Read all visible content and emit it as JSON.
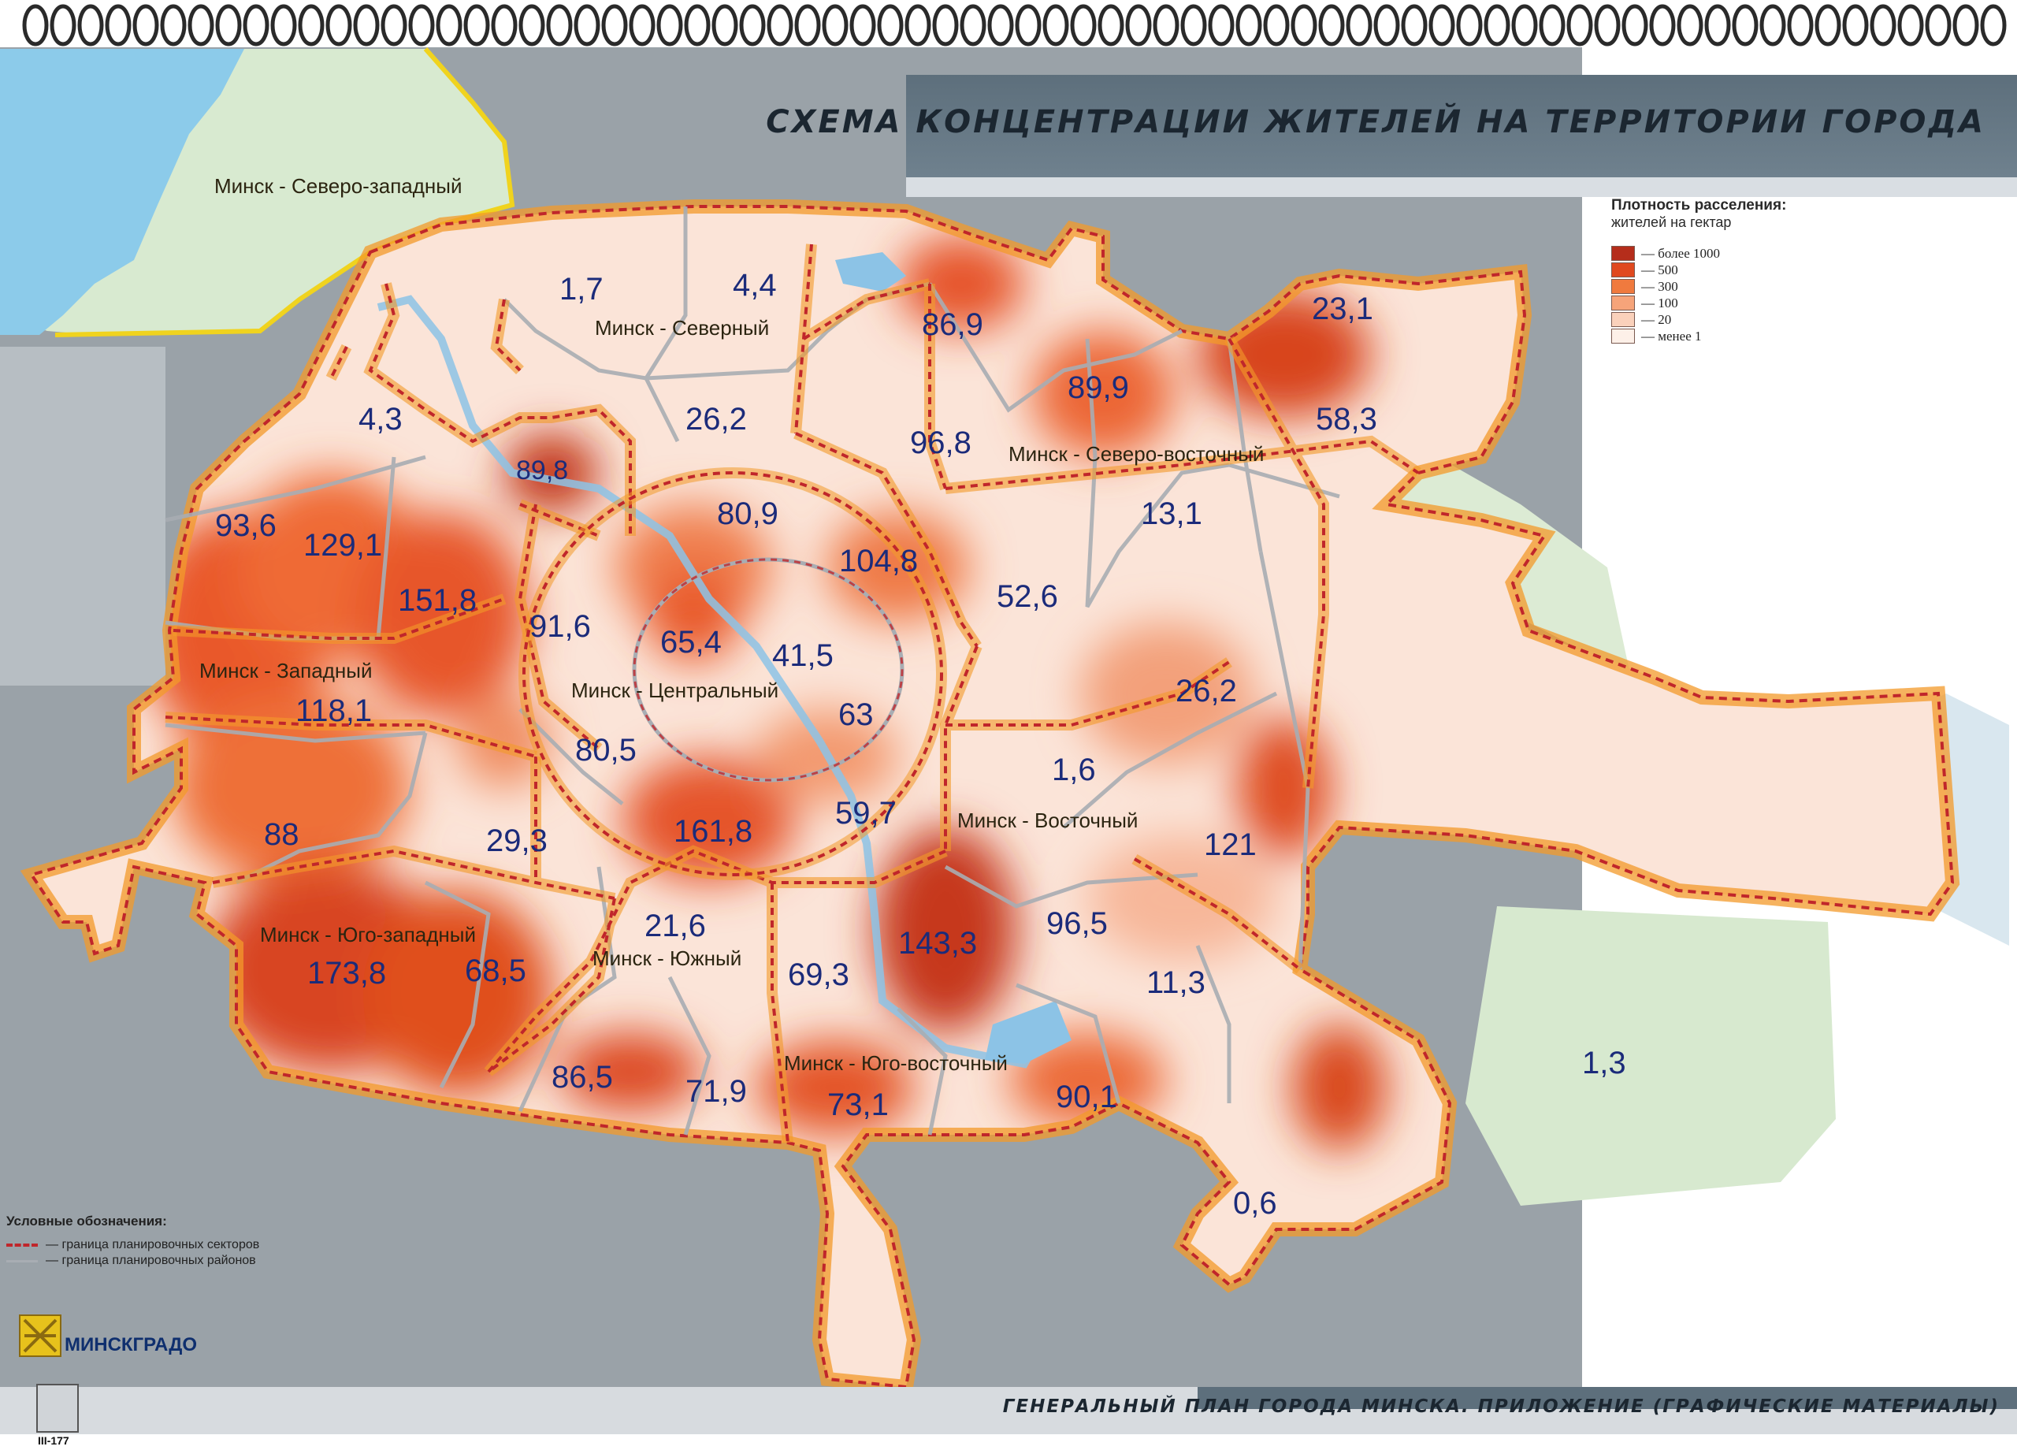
{
  "title": "СХЕМА КОНЦЕНТРАЦИИ ЖИТЕЛЕЙ НА ТЕРРИТОРИИ ГОРОДА",
  "legend": {
    "title": "Плотность расселения:",
    "subtitle": "жителей на гектар",
    "items": [
      {
        "label": "— более 1000",
        "color": "#b52d1b"
      },
      {
        "label": "— 500",
        "color": "#e0491f"
      },
      {
        "label": "— 300",
        "color": "#f07a3e"
      },
      {
        "label": "— 100",
        "color": "#f6a47a"
      },
      {
        "label": "— 20",
        "color": "#fad1bb"
      },
      {
        "label": "— менее 1",
        "color": "#fdf0e8"
      }
    ]
  },
  "notation": {
    "title": "Условные обозначения:",
    "sector_boundary": "— граница планировочных секторов",
    "district_boundary": "— граница планировочных районов"
  },
  "sectors": [
    {
      "name": "Минск - Северо-западный"
    },
    {
      "name": "Минск - Северный"
    },
    {
      "name": "Минск - Северо-восточный"
    },
    {
      "name": "Минск - Западный"
    },
    {
      "name": "Минск - Центральный"
    },
    {
      "name": "Минск - Восточный"
    },
    {
      "name": "Минск - Юго-западный"
    },
    {
      "name": "Минск - Южный"
    },
    {
      "name": "Минск - Юго-восточный"
    }
  ],
  "densities": [
    "1,7",
    "4,4",
    "86,9",
    "23,1",
    "4,3",
    "26,2",
    "89,9",
    "58,3",
    "96,8",
    "89,8",
    "93,6",
    "129,1",
    "80,9",
    "13,1",
    "104,8",
    "151,8",
    "91,6",
    "65,4",
    "41,5",
    "52,6",
    "118,1",
    "26,2",
    "63",
    "80,5",
    "1,6",
    "88",
    "29,3",
    "161,8",
    "59,7",
    "121",
    "21,6",
    "96,5",
    "173,8",
    "68,5",
    "143,3",
    "69,3",
    "11,3",
    "86,5",
    "71,9",
    "73,1",
    "90,1",
    "1,3",
    "0,6"
  ],
  "logo": "МИНСКГРАДО",
  "footer": "ГЕНЕРАЛЬНЫЙ ПЛАН ГОРОДА МИНСКА.  ПРИЛОЖЕНИЕ (ГРАФИЧЕСКИЕ МАТЕРИАЛЫ)",
  "page_number": "III-177",
  "colors": {
    "sector_boundary": "#c0262b",
    "district_boundary": "#a8adb3",
    "label_text": "#1b2b7a",
    "greenery": "#cfe6c7",
    "water": "#8cc3e6"
  }
}
